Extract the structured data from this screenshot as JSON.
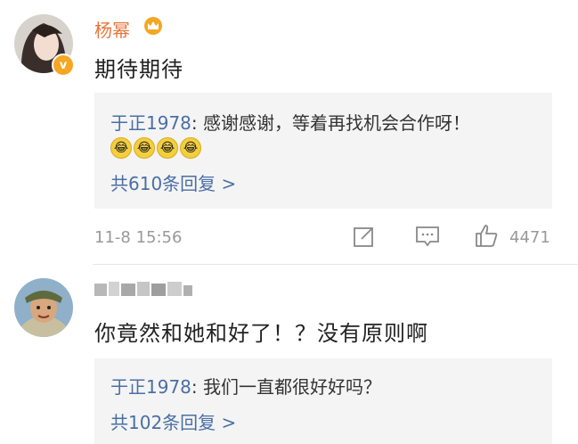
{
  "comments": [
    {
      "username": "杨幂",
      "text": "期待期待",
      "reply": {
        "author": "于正1978",
        "text": "感谢感谢，等着再找机会合作呀！",
        "emoji_count": 4,
        "more": "共610条回复 >"
      },
      "timestamp": "11-8 15:56",
      "likes": "4471"
    },
    {
      "username": "",
      "text": "你竟然和她和好了！？没有原则啊",
      "reply": {
        "author": "于正1978",
        "text": "我们一直都很好好吗？",
        "more": "共102条回复 >"
      }
    }
  ],
  "colors": {
    "username": "#e8743b",
    "link": "#4a6fa5",
    "reply_bg": "#f4f4f4",
    "meta": "#999999"
  },
  "icons": [
    "crown-icon",
    "verified-badge-icon",
    "edit-icon",
    "comment-icon",
    "thumb-up-icon"
  ]
}
